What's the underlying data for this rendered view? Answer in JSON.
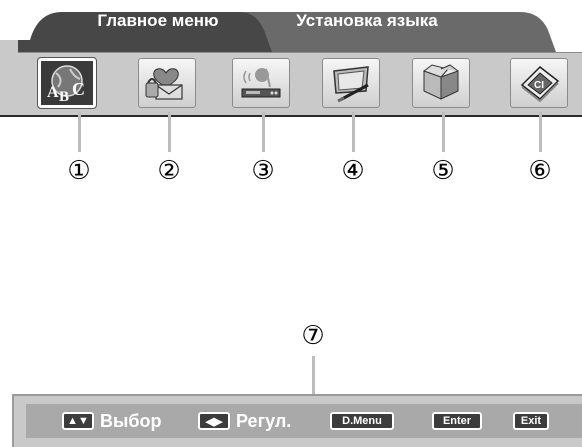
{
  "tabs": {
    "main_menu": "Главное меню",
    "language_setup": "Установка языка"
  },
  "icons": [
    {
      "name": "language-abc-icon",
      "callout": "①"
    },
    {
      "name": "mail-icon",
      "callout": "②"
    },
    {
      "name": "antenna-receiver-icon",
      "callout": "③"
    },
    {
      "name": "screen-edit-icon",
      "callout": "④"
    },
    {
      "name": "box-icon",
      "callout": "⑤"
    },
    {
      "name": "ci-card-icon",
      "callout": "⑥"
    }
  ],
  "bottom_callout": "⑦",
  "bottom_bar": {
    "updown_key": "▲▼",
    "select_label": "Выбор",
    "leftright_key": "◀▶",
    "adjust_label": "Регул.",
    "dmenu_key": "D.Menu",
    "enter_key": "Enter",
    "exit_key": "Exit"
  },
  "colors": {
    "tab_dark": "#4a4a4a",
    "strip": "#c9c9c9",
    "selected_box": "#3a3a3a"
  }
}
